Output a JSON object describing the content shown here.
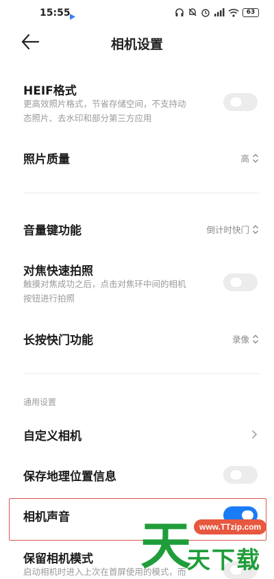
{
  "status_bar": {
    "time": "15:55",
    "battery": "63"
  },
  "header": {
    "title": "相机设置"
  },
  "settings": {
    "heif": {
      "title": "HEIF格式",
      "desc_line1": "更高效照片格式，节省存储空间，不支持动",
      "desc_line2": "态照片、去水印和部分第三方应用",
      "enabled": false
    },
    "photo_quality": {
      "title": "照片质量",
      "value": "高"
    },
    "volume_key": {
      "title": "音量键功能",
      "value": "倒计时快门"
    },
    "focus_shot": {
      "title": "对焦快速拍照",
      "desc_line1": "触摸对焦成功之后，点击对焦环中间的相机",
      "desc_line2": "按钮进行拍照",
      "enabled": false
    },
    "long_press_shutter": {
      "title": "长按快门功能",
      "value": "录像"
    },
    "general_section_label": "通用设置",
    "custom_camera": {
      "title": "自定义相机"
    },
    "save_location": {
      "title": "保存地理位置信息",
      "enabled": false
    },
    "camera_sound": {
      "title": "相机声音",
      "enabled": true
    },
    "keep_mode": {
      "title": "保留相机模式",
      "desc_line1": "启动相机时进入上次在首屏使用的模式，而",
      "enabled": false
    }
  },
  "watermark": {
    "url": "www.TTzip.com",
    "big_char": "天",
    "text": "天下载"
  },
  "colors": {
    "accent": "#1a7cf5",
    "highlight": "#d9534f",
    "watermark_green": "#1f9d3a"
  }
}
